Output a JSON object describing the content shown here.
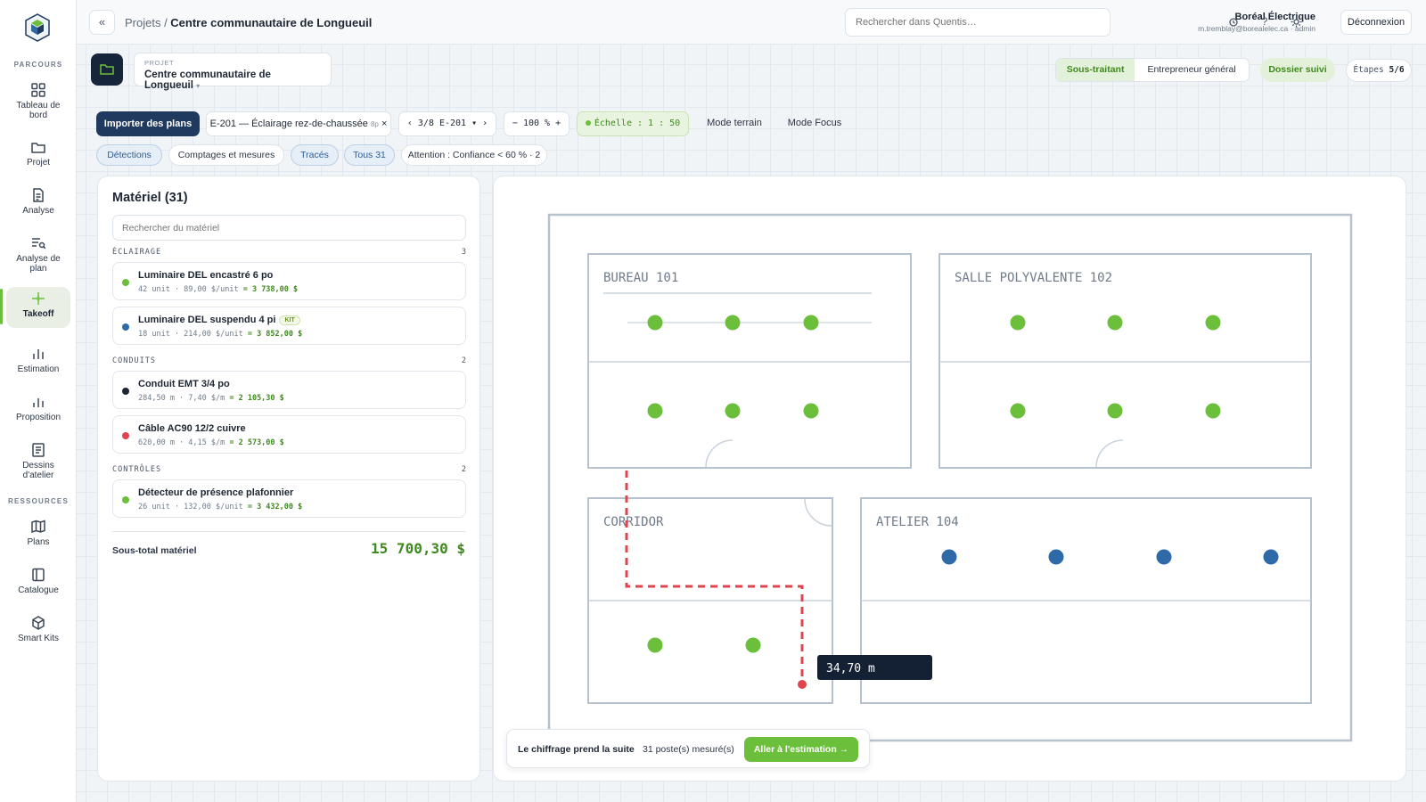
{
  "nav": {
    "section_parcours": "PARCOURS",
    "section_ressources": "RESSOURCES",
    "items": [
      {
        "label": "Tableau de bord"
      },
      {
        "label": "Projet"
      },
      {
        "label": "Analyse"
      },
      {
        "label": "Analyse de plan"
      },
      {
        "label": "Takeoff"
      },
      {
        "label": "Estimation"
      },
      {
        "label": "Proposition"
      },
      {
        "label": "Dessins d'atelier"
      },
      {
        "label": "Plans"
      },
      {
        "label": "Catalogue"
      },
      {
        "label": "Smart Kits"
      }
    ],
    "active": "Takeoff"
  },
  "topbar": {
    "collapse": "«",
    "breadcrumb_root": "Projets / ",
    "breadcrumb_current": "Centre communautaire de Longueuil",
    "search_placeholder": "Rechercher dans Quentis…",
    "user_name": "Boréal Électrique",
    "user_email": "m.tremblay@borealelec.ca · admin",
    "help": "?",
    "logout": "Déconnexion"
  },
  "project": {
    "caption": "PROJET",
    "name": "Centre communautaire de Longueuil",
    "role_on": "Sous-traitant",
    "role_off": "Entrepreneur général",
    "status": "Dossier suivi",
    "steps_label": "Étapes",
    "steps_value": "5/6"
  },
  "toolbar": {
    "import": "Importer des plans",
    "sheet": "E-201 — Éclairage rez-de-chaussée",
    "sheet_tag": "8p",
    "sheet_close": "×",
    "pager": "‹ 3/8 E-201 ▾ ›",
    "zoom": "− 100 % +",
    "scale": "Échelle : 1 : 50",
    "mode_terrain": "Mode terrain",
    "mode_focus": "Mode Focus"
  },
  "filters": {
    "detections": "Détections",
    "counts": "Comptages et mesures",
    "traces": "Tracés",
    "all": "Tous 31",
    "attention": "Attention : Confiance < 60 % · 2"
  },
  "materials": {
    "title": "Matériel (31)",
    "search_placeholder": "Rechercher du matériel",
    "groups": [
      {
        "name": "ÉCLAIRAGE",
        "count": "3"
      },
      {
        "name": "CONDUITS",
        "count": "2"
      },
      {
        "name": "CONTRÔLES",
        "count": "2"
      }
    ],
    "items": [
      {
        "name": "Luminaire DEL encastré 6 po",
        "detail": "42 unit · 89,00 $/unit",
        "total": "= 3 738,00 $",
        "color": "#6bbf3b"
      },
      {
        "name": "Luminaire DEL suspendu 4 pi",
        "badge": "KIT",
        "detail": "18 unit · 214,00 $/unit",
        "total": "= 3 852,00 $",
        "color": "#2f6aa8"
      },
      {
        "name": "Conduit EMT 3/4 po",
        "detail": "284,50 m · 7,40 $/m",
        "total": "= 2 105,30 $",
        "color": "#1e2633"
      },
      {
        "name": "Câble AC90 12/2 cuivre",
        "detail": "620,00 m · 4,15 $/m",
        "total": "= 2 573,00 $",
        "color": "#e0444e"
      },
      {
        "name": "Détecteur de présence plafonnier",
        "detail": "26 unit · 132,00 $/unit",
        "total": "= 3 432,00 $",
        "color": "#6bbf3b"
      }
    ],
    "subtotal_label": "Sous-total matériel",
    "subtotal_value": "15 700,30 $"
  },
  "plan": {
    "rooms": [
      "BUREAU 101",
      "SALLE POLYVALENTE 102",
      "CORRIDOR",
      "ATELIER 104"
    ],
    "measure_label": "34,70 m"
  },
  "footer_strip": {
    "title": "Le chiffrage prend la suite",
    "count": "31 poste(s) mesuré(s)",
    "cta": "Aller à l'estimation →"
  },
  "colors": {
    "accent": "#6bbf3b",
    "primary": "#203a5f",
    "fixture_blue": "#2f6aa8",
    "trace_red": "#e0444e"
  }
}
